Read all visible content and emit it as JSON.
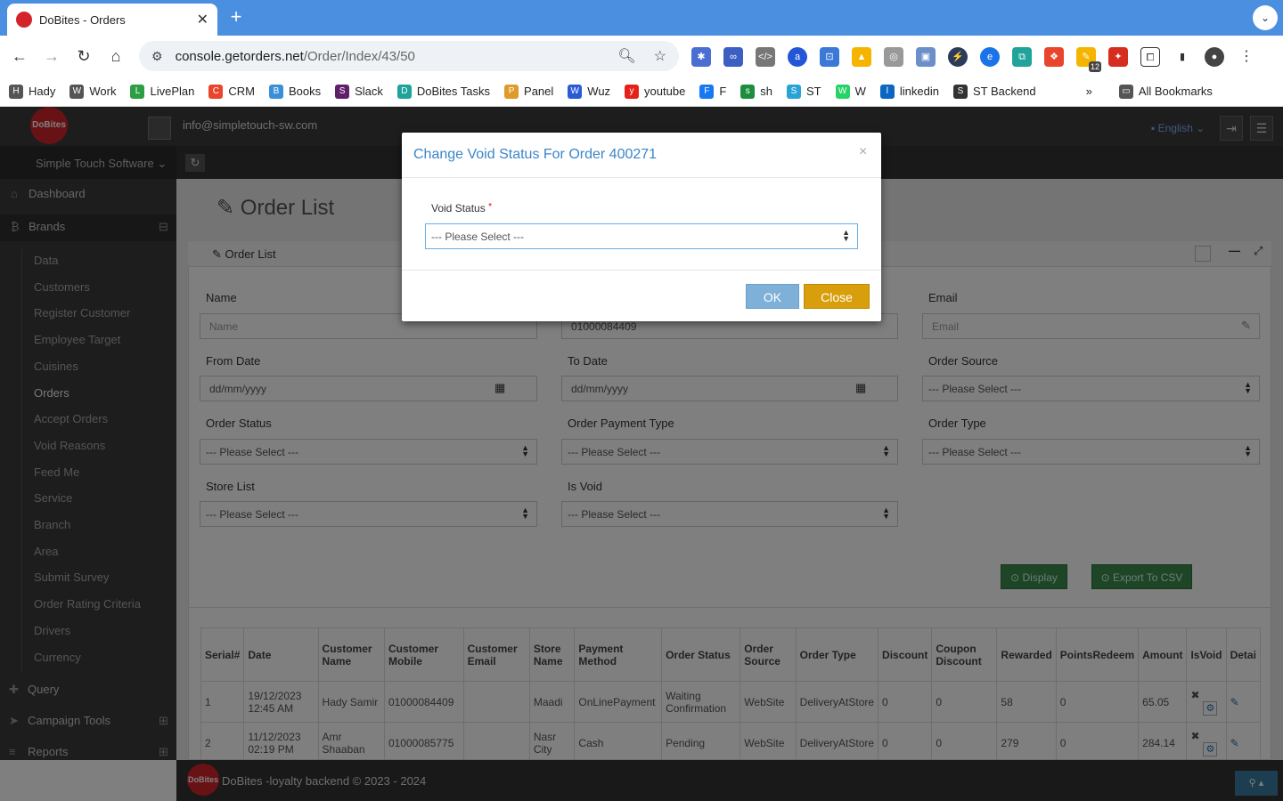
{
  "browser": {
    "tab_title": "DoBites - Orders",
    "url_host": "console.getorders.net",
    "url_path": "/Order/Index/43/50",
    "ext_badge": "12",
    "bookmarks": [
      {
        "label": "Hady",
        "icon": "folder-icon",
        "color": "#555555"
      },
      {
        "label": "Work",
        "icon": "folder-icon",
        "color": "#555555"
      },
      {
        "label": "LivePlan",
        "icon": "chart-icon",
        "color": "#2e9e44"
      },
      {
        "label": "CRM",
        "icon": "crm-icon",
        "color": "#e8452c"
      },
      {
        "label": "Books",
        "icon": "books-icon",
        "color": "#3a8fd9"
      },
      {
        "label": "Slack",
        "icon": "slack-icon",
        "color": "#611f69"
      },
      {
        "label": "DoBites Tasks",
        "icon": "tasks-icon",
        "color": "#1fa39a"
      },
      {
        "label": "Panel",
        "icon": "home-icon",
        "color": "#e09a2a"
      },
      {
        "label": "Wuz",
        "icon": "w-icon",
        "color": "#2a5bd7"
      },
      {
        "label": "youtube",
        "icon": "youtube-icon",
        "color": "#e62117"
      },
      {
        "label": "F",
        "icon": "facebook-icon",
        "color": "#1877f2"
      },
      {
        "label": "sh",
        "icon": "sheets-icon",
        "color": "#1e8e3e"
      },
      {
        "label": "ST",
        "icon": "st-icon",
        "color": "#29a3d6"
      },
      {
        "label": "W",
        "icon": "whatsapp-icon",
        "color": "#25d366"
      },
      {
        "label": "linkedin",
        "icon": "linkedin-icon",
        "color": "#0a66c2"
      },
      {
        "label": "ST Backend",
        "icon": "globe-icon",
        "color": "#333333"
      }
    ],
    "all_bookmarks": "All Bookmarks"
  },
  "header": {
    "logo_text": "DoBites",
    "user_email": "info@simpletouch-sw.com",
    "language": "English"
  },
  "sidebar": {
    "brand": "Simple Touch Software",
    "top_items": [
      {
        "label": "Dashboard",
        "icon": "home-icon"
      },
      {
        "label": "Brands",
        "icon": "bitcoin-icon"
      }
    ],
    "sub_items": [
      "Data",
      "Customers",
      "Register Customer",
      "Employee Target",
      "Cuisines",
      "Orders",
      "Accept Orders",
      "Void Reasons",
      "Feed Me",
      "Service",
      "Branch",
      "Area",
      "Submit Survey",
      "Order Rating Criteria",
      "Drivers",
      "Currency"
    ],
    "bottom_items": [
      {
        "label": "Query",
        "icon": "puzzle-icon"
      },
      {
        "label": "Campaign Tools",
        "icon": "send-icon"
      },
      {
        "label": "Reports",
        "icon": "database-icon"
      }
    ]
  },
  "page": {
    "title": "Order List",
    "panel_title": "Order List",
    "filters": {
      "name_label": "Name",
      "name_placeholder": "Name",
      "mobile_value": "01000084409",
      "email_label": "Email",
      "email_placeholder": "Email",
      "from_label": "From Date",
      "from_value": "dd/mm/yyyy",
      "to_label": "To Date",
      "to_value": "dd/mm/yyyy",
      "source_label": "Order Source",
      "status_label": "Order Status",
      "payment_label": "Order Payment Type",
      "type_label": "Order Type",
      "store_label": "Store List",
      "void_label": "Is Void",
      "please_select": "--- Please Select ---"
    },
    "display_btn": "Display",
    "export_btn": "Export To CSV",
    "table": {
      "headers": [
        "Serial#",
        "Date",
        "Customer Name",
        "Customer Mobile",
        "Customer Email",
        "Store Name",
        "Payment Method",
        "Order Status",
        "Order Source",
        "Order Type",
        "Discount",
        "Coupon Discount",
        "Rewarded",
        "PointsRedeem",
        "Amount",
        "IsVoid",
        "Detai"
      ],
      "rows": [
        [
          "1",
          "19/12/2023 12:45 AM",
          "Hady Samir",
          "01000084409",
          "",
          "Maadi",
          "OnLinePayment",
          "Waiting Confirmation",
          "WebSite",
          "DeliveryAtStore",
          "0",
          "0",
          "58",
          "0",
          "65.05"
        ],
        [
          "2",
          "11/12/2023 02:19 PM",
          "Amr Shaaban",
          "01000085775",
          "",
          "Nasr City",
          "Cash",
          "Pending",
          "WebSite",
          "DeliveryAtStore",
          "0",
          "0",
          "279",
          "0",
          "284.14"
        ]
      ]
    }
  },
  "footer": {
    "text": "DoBites -loyalty backend © 2023 - 2024",
    "logo_text": "DoBites"
  },
  "modal": {
    "title": "Change Void Status For Order 400271",
    "field_label": "Void Status",
    "required_mark": "*",
    "select_value": "--- Please Select ---",
    "ok": "OK",
    "close": "Close",
    "close_x": "×"
  },
  "colors": {
    "brand": "#d3242b",
    "accent": "#3a86c8",
    "ok": "#7fb0d8",
    "close": "#d99e0b",
    "green": "#3c8a4a"
  }
}
